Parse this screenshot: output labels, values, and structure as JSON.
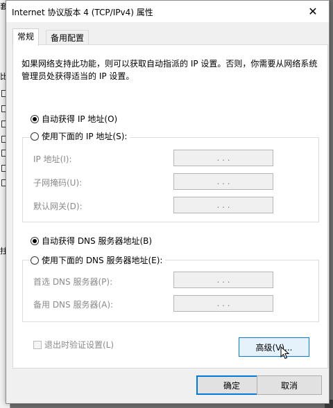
{
  "background": {
    "fragments": [
      "套",
      "比",
      "拄"
    ]
  },
  "window": {
    "title": "Internet 协议版本 4 (TCP/IPv4) 属性",
    "close_glyph": "✕"
  },
  "tabs": [
    {
      "label": "常规",
      "active": true
    },
    {
      "label": "备用配置",
      "active": false
    }
  ],
  "description": "如果网络支持此功能，则可以获取自动指派的 IP 设置。否则，你需要从网络系统管理员处获得适当的 IP 设置。",
  "ip_section": {
    "auto_label": "自动获得 IP 地址(O)",
    "auto_checked": true,
    "manual_label": "使用下面的 IP 地址(S):",
    "manual_checked": false,
    "fields": [
      {
        "label": "IP 地址(I):",
        "value": ". . ."
      },
      {
        "label": "子网掩码(U):",
        "value": ". . ."
      },
      {
        "label": "默认网关(D):",
        "value": ". . ."
      }
    ]
  },
  "dns_section": {
    "auto_label": "自动获得 DNS 服务器地址(B)",
    "auto_checked": true,
    "manual_label": "使用下面的 DNS 服务器地址(E):",
    "manual_checked": false,
    "fields": [
      {
        "label": "首选 DNS 服务器(P):",
        "value": ". . ."
      },
      {
        "label": "备用 DNS 服务器(A):",
        "value": ". . ."
      }
    ]
  },
  "validate_checkbox": {
    "label": "退出时验证设置(L)",
    "checked": false
  },
  "buttons": {
    "advanced": "高级(V)...",
    "ok": "确定",
    "cancel": "取消"
  },
  "colors": {
    "accent": "#0078d7",
    "disabled_text": "#8a8a8a"
  }
}
